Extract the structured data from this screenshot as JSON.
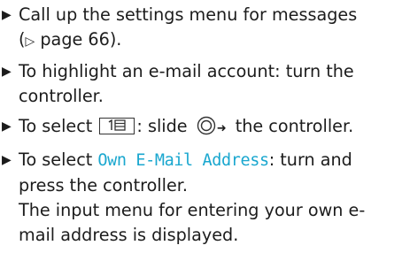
{
  "steps": [
    {
      "line1": "Call up the settings menu for messages",
      "line2_pre": "(",
      "ref_glyph": "▷",
      "line2_post": " page 66)."
    },
    {
      "line1": "To highlight an e-mail account: turn the",
      "line2": "controller."
    },
    {
      "pre": "To select ",
      "mid": ": slide ",
      "arrow": "➜",
      "post": " the controller.",
      "soft_key_icon": "menu-list-icon",
      "controller_icon": "rotary-controller-icon"
    },
    {
      "pre": "To select ",
      "ui_label": "Own E-Mail Address",
      "post": ": turn and",
      "line2": "press the controller.",
      "line3": "The input menu for entering your own e-",
      "line4": "mail address is displayed."
    }
  ],
  "bullet_glyph": "▶",
  "colors": {
    "text": "#1c1c1c",
    "ui_text": "#1aa7cf"
  }
}
